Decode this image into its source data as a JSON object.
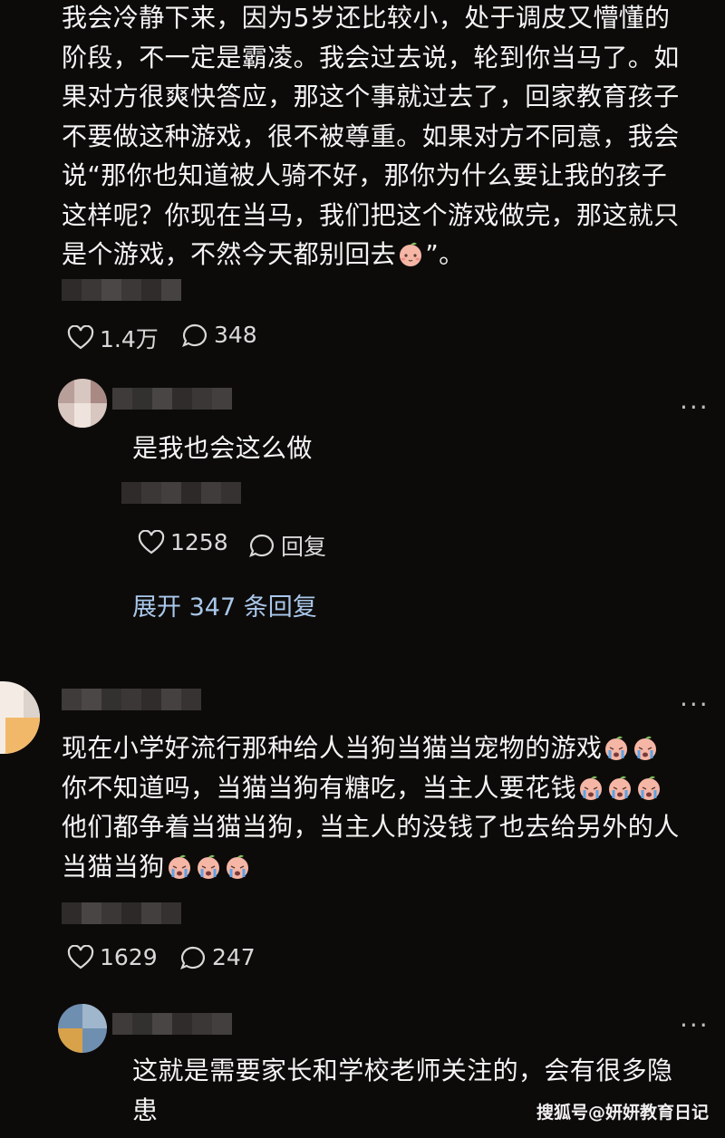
{
  "post": {
    "text_line1": "我会冷静下来，因为5岁还比较小，处于调皮又懵懂的",
    "text_line2": "阶段，不一定是霸凌。我会过去说，轮到你当马了。如",
    "text_line3": "果对方很爽快答应，那这个事就过去了，回家教育孩子",
    "text_line4": "不要做这种游戏，很不被尊重。如果对方不同意，我会",
    "text_line5": "说“那你也知道被人骑不好，那你为什么要让我的孩子",
    "text_line6": "这样呢？你现在当马，我们把这个游戏做完，那这就只",
    "text_line7": "是个游戏，不然今天都别回去",
    "text_line7_end": "”。",
    "likes": "1.4万",
    "comments": "348"
  },
  "reply1": {
    "text": "是我也会这么做",
    "likes": "1258",
    "reply_label": "回复",
    "expand_label": "展开 347 条回复"
  },
  "comment2": {
    "line1": "现在小学好流行那种给人当狗当猫当宠物的游戏",
    "line2": "你不知道吗，当猫当狗有糖吃，当主人要花钱",
    "line3": "他们都争着当猫当狗，当主人的没钱了也去给另外的人",
    "line4": "当猫当狗",
    "likes": "1629",
    "comments": "247"
  },
  "reply2": {
    "line1": "这就是需要家长和学校老师关注的，会有很多隐",
    "line2": "患"
  },
  "more_icon_label": "···",
  "watermark": "搜狐号@妍妍教育日记",
  "icons": [
    "heart-icon",
    "comment-bubble-icon",
    "more-dots-icon",
    "peach-face-emoji",
    "crying-face-emoji"
  ]
}
